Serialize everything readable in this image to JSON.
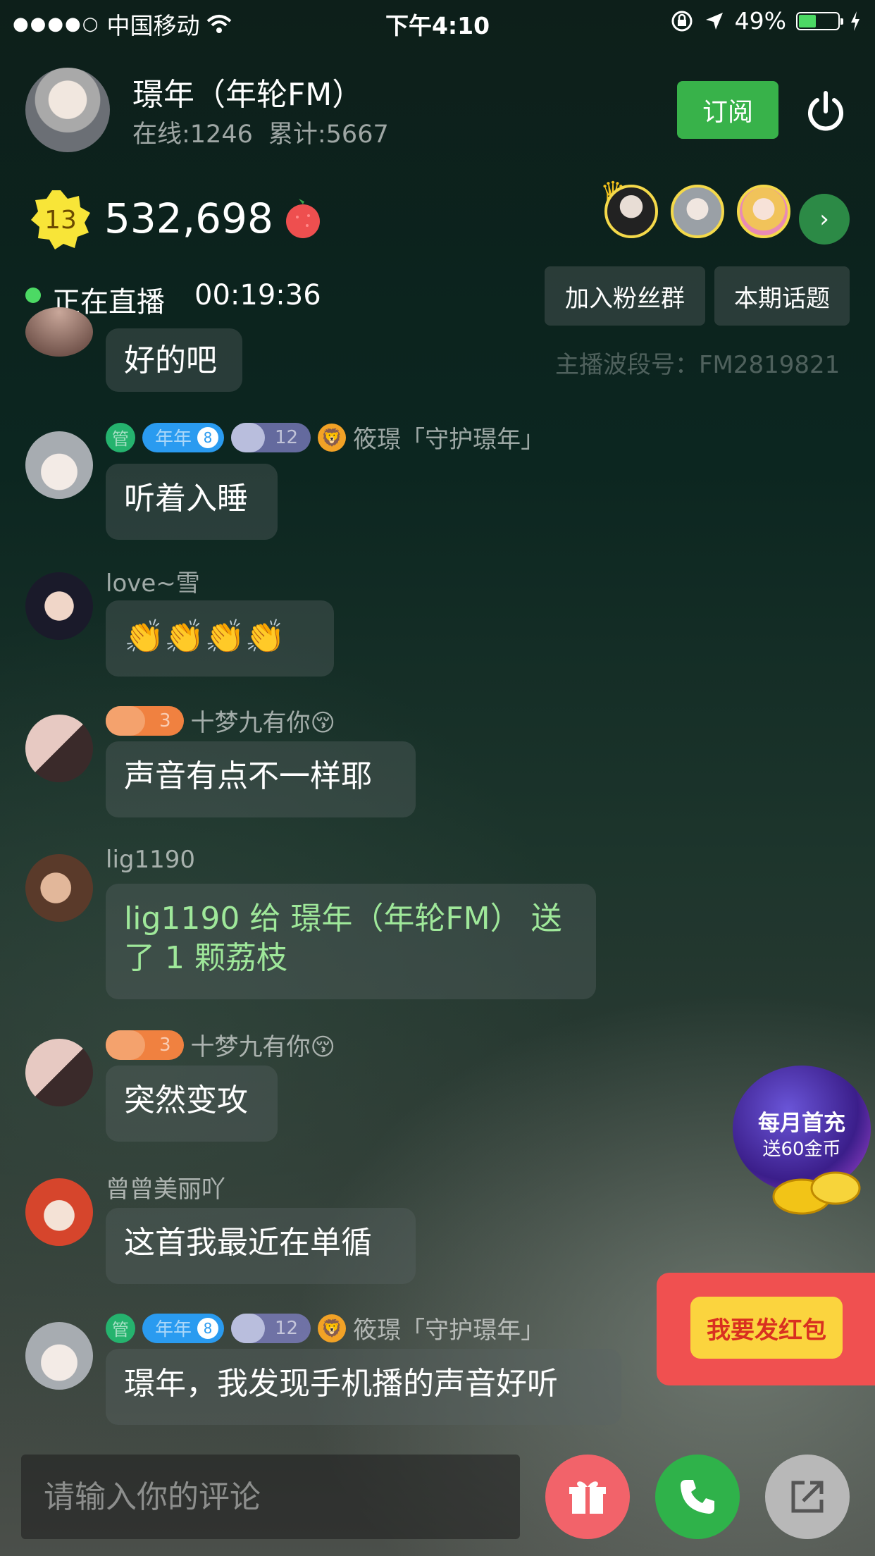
{
  "status_bar": {
    "signal_dots": "●●●●○",
    "carrier": "中国移动",
    "time": "下午4:10",
    "battery_percent": "49%",
    "battery_level": 0.49
  },
  "host": {
    "name": "璟年（年轮FM）",
    "online": "在线:1246",
    "total": "累计:5667",
    "subscribe_label": "订阅"
  },
  "coins": {
    "level": "13",
    "count": "532,698"
  },
  "live": {
    "label": "正在直播",
    "duration": "00:19:36",
    "join_fans_label": "加入粉丝群",
    "topic_label": "本期话题",
    "frequency": "主播波段号：FM2819821"
  },
  "messages": [
    {
      "text": "好的吧"
    },
    {
      "badge_admin": "管",
      "badge_fan": "年年",
      "badge_fan_level": "8",
      "badge_vip": "12",
      "username": "筱璟「守护璟年」",
      "text": "听着入睡"
    },
    {
      "username": "love~雪",
      "text": "👏👏👏👏"
    },
    {
      "badge_orange": "3",
      "username": "十梦九有你😚",
      "text": "声音有点不一样耶"
    },
    {
      "username": "lig1190",
      "text": "lig1190 给 璟年（年轮FM） 送了 1 颗荔枝"
    },
    {
      "badge_orange": "3",
      "username": "十梦九有你😚",
      "text": "突然变攻"
    },
    {
      "username": "曾曾美丽吖",
      "text": "这首我最近在单循"
    },
    {
      "badge_admin": "管",
      "badge_fan": "年年",
      "badge_fan_level": "8",
      "badge_vip": "12",
      "username": "筱璟「守护璟年」",
      "text": "璟年，我发现手机播的声音好听"
    }
  ],
  "promo": {
    "line1": "每月首充",
    "line2": "送60金币"
  },
  "red_packet": {
    "label": "我要发红包"
  },
  "bottom": {
    "comment_placeholder": "请输入你的评论"
  },
  "colors": {
    "accent_green": "#38b24a",
    "gift_text": "#9fe89a",
    "red_packet": "#f05050",
    "gift_button": "#f2636a",
    "call_button": "#2fb24a",
    "share_button": "#b8b8b8"
  },
  "icons": [
    "wifi-icon",
    "lock-rotation-icon",
    "location-arrow-icon",
    "charging-icon",
    "power-icon",
    "lychee-icon",
    "crown-icon",
    "chevron-right-icon",
    "gift-icon",
    "phone-icon",
    "share-icon",
    "lion-icon"
  ]
}
